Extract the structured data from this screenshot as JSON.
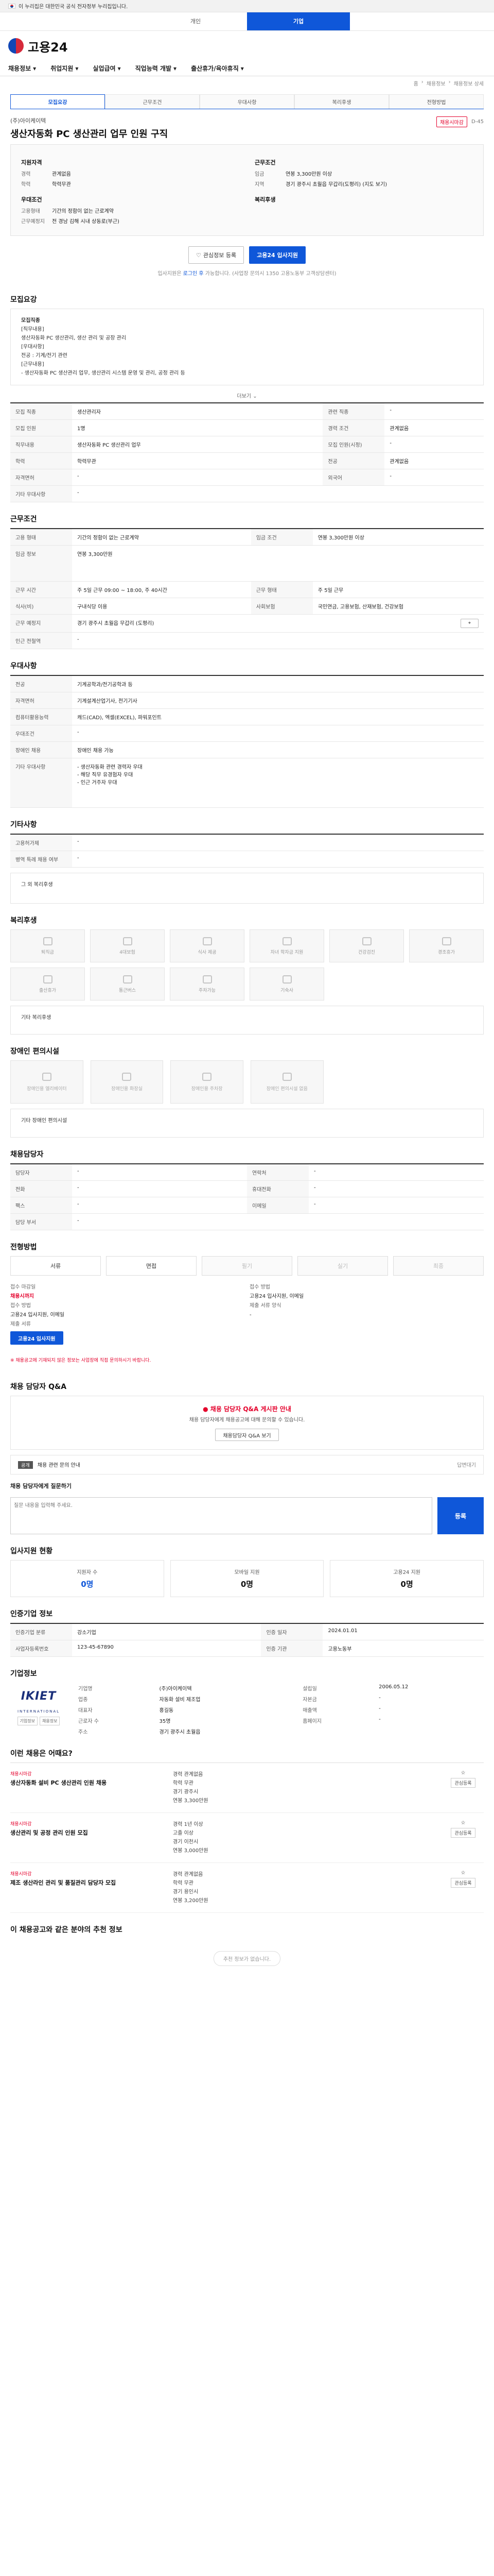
{
  "gov_banner": {
    "text": "이 누리집은 대한민국 공식 전자정부 누리집입니다."
  },
  "top_tabs": [
    "개인",
    "기업"
  ],
  "brand": {
    "name": "고용24"
  },
  "nav": [
    "채용정보",
    "취업지원",
    "실업급여",
    "직업능력 개발",
    "출산휴가/육아휴직"
  ],
  "breadcrumb": [
    "홈",
    "채용정보",
    "채용정보 상세"
  ],
  "tabs": [
    "모집요강",
    "근무조건",
    "우대사항",
    "복리후생",
    "전형방법"
  ],
  "job": {
    "company": "(주)아이케이텍",
    "title": "생산자동화 PC 생산관리 업무 인원 구직",
    "badge": "채용시마감",
    "dday": "D-45"
  },
  "summary": {
    "left_title": "지원자격",
    "left_rows": [
      {
        "k": "경력",
        "v": "관계없음"
      },
      {
        "k": "학력",
        "v": "학력무관"
      }
    ],
    "left_title2": "우대조건",
    "left_rows2": [
      {
        "k": "고용형태",
        "v": "기간의 정함이 없는 근로계약"
      },
      {
        "k": "근무예정지",
        "v": "전 경남 김해 시내 상동로(부근)"
      }
    ],
    "right_title": "근무조건",
    "right_rows": [
      {
        "k": "임금",
        "v": "연봉 3,300만원 이상"
      },
      {
        "k": "지역",
        "v": "경기 광주시 초월읍 무갑리(도평리) (지도 보기)"
      }
    ],
    "right_title2": "복리후생",
    "right_rows2": []
  },
  "actions": {
    "scrap": "관심정보 등록",
    "apply": "고용24 입사지원"
  },
  "notice": {
    "pre": "입사지원은 ",
    "link": "로그인 후",
    "post": " 가능합니다. (사업장 문의시 1350 고용노동부 고객상담센터)"
  },
  "sections": {
    "recruit": "모집요강",
    "work": "근무조건",
    "pref": "우대사항",
    "etc": "기타사항",
    "welfare": "복리후생",
    "disabled": "장애인 편의시설",
    "dept": "채용담당자",
    "process": "전형방법",
    "qa": "채용 담당자 Q&A",
    "stat": "입사지원 현황",
    "info": "인증기업 정보",
    "company": "기업정보",
    "recs": "이런 채용은 어때요?",
    "aicaution": "이 채용공고와 같은 분야의 추천 정보"
  },
  "recruit_box": {
    "lines": [
      "모집직종",
      "[직무내용]",
      "생산자동화 PC 생산관리, 생산 관리 및 공장 관리",
      "[우대사항]",
      "전공 : 기계/전기 관련",
      "[근무내용]",
      "- 생산자동화 PC 생산관리 업무, 생산관리 시스템 운영 및 관리, 공정 관리 등"
    ],
    "more": "더보기"
  },
  "recruit_table": [
    [
      "모집 직종",
      "생산관리자",
      "관련 직종",
      "-"
    ],
    [
      "모집 인원",
      "1명",
      "경력 조건",
      "관계없음"
    ],
    [
      "직무내용",
      "생산자동화 PC 생산관리 업무",
      "모집 인원(시정)",
      "-"
    ],
    [
      "학력",
      "학력무관",
      "전공",
      "관계없음"
    ],
    [
      "자격면허",
      "-",
      "외국어",
      "-"
    ],
    [
      "기타 우대사항",
      "-",
      "",
      ""
    ]
  ],
  "work_table": [
    [
      "고용 형태",
      "기간의 정함이 없는 근로계약",
      "임금 조건",
      "연봉 3,300만원 이상"
    ],
    [
      "임금 정보",
      "연봉 3,300만원",
      "",
      ""
    ],
    [
      "근무 시간",
      "주 5일 근무 09:00 ~ 18:00, 주 40시간",
      "근무 형태",
      "주 5일 근무"
    ],
    [
      "식사(비)",
      "구내식당 이용",
      "사회보험",
      "국민연금, 고용보험, 산재보험, 건강보험"
    ],
    [
      "근무 예정지",
      "경기 광주시 초월읍 무갑리 (도평리)",
      "",
      ""
    ],
    [
      "인근 전철역",
      "-",
      "",
      ""
    ]
  ],
  "pref_table": [
    [
      "전공",
      "기계공학과/전기공학과 등"
    ],
    [
      "자격면허",
      "기계설계산업기사, 전기기사"
    ],
    [
      "컴퓨터활용능력",
      "캐드(CAD), 엑셀(EXCEL), 파워포인트"
    ],
    [
      "우대조건",
      "-"
    ],
    [
      "장애인 채용",
      "장애인 채용 가능"
    ],
    [
      "기타 우대사항",
      "- 생산자동화 관련 경력자 우대\n- 해당 직무 유경험자 우대\n- 인근 거주자 우대"
    ]
  ],
  "etc_table": [
    [
      "고용허가제",
      "-"
    ],
    [
      "병역 특례 채용 여부",
      "-"
    ]
  ],
  "etc_text": "그 외 복리후생",
  "welfare_items": [
    "퇴직금",
    "4대보험",
    "식사 제공",
    "자녀 학자금 지원",
    "건강검진",
    "경조휴가",
    "출산휴가",
    "통근버스",
    "주차가능",
    "기숙사"
  ],
  "welfare_note": "기타 복리후생",
  "disabled_items": [
    "장애인용 엘리베이터",
    "장애인용 화장실",
    "장애인용 주차장",
    "장애인 편의시설 없음"
  ],
  "disabled_note": "기타 장애인 편의시설",
  "dept_table": [
    [
      "담당자",
      "-",
      "연락처",
      "-"
    ],
    [
      "전화",
      "-",
      "휴대전화",
      "-"
    ],
    [
      "팩스",
      "-",
      "이메일",
      "-"
    ],
    [
      "담당 부서",
      "-",
      "",
      ""
    ]
  ],
  "process_steps": [
    "서류",
    "면접",
    "필기",
    "실기",
    "최종"
  ],
  "apply_info": {
    "left": [
      "접수 마감일",
      "채용시까지",
      "접수 방법",
      "고용24 입사지원, 이메일",
      "제출 서류"
    ],
    "right": [
      "접수 방법",
      "고용24 입사지원, 이메일",
      "제출 서류 양식",
      "-"
    ],
    "apply_btn": "고용24 입사지원"
  },
  "process_note": "※ 채용공고에 기재되지 않은 정보는 사업장에 직접 문의하시기 바랍니다.",
  "qa": {
    "title": "채용 담당자 Q&A 게시판 안내",
    "desc": "채용 담당자에게 채용공고에 대해 문의할 수 있습니다.",
    "link": "채용담당자 Q&A 보기",
    "item_tag": "공개",
    "item_title": "채용 관련 문의 안내",
    "item_reply": "답변대기",
    "input_title": "채용 담당자에게 질문하기",
    "placeholder": "질문 내용을 입력해 주세요.",
    "submit": "등록"
  },
  "stat": [
    {
      "label": "지원자 수",
      "value": "0명"
    },
    {
      "label": "모바일 지원",
      "value": "0명"
    },
    {
      "label": "고용24 지원",
      "value": "0명"
    }
  ],
  "info_table": [
    [
      "인증기업 분류",
      "강소기업",
      "인증 일자",
      "2024.01.01"
    ],
    [
      "사업자등록번호",
      "123-45-67890",
      "인증 기관",
      "고용노동부"
    ]
  ],
  "company": {
    "logo": "IKIET",
    "logo_sub": "INTERNATIONAL",
    "logo_btns": [
      "기업정보",
      "채용정보"
    ],
    "rows": [
      [
        "기업명",
        "(주)아이케이텍",
        "설립일",
        "2006.05.12"
      ],
      [
        "업종",
        "자동화 설비 제조업",
        "자본금",
        "-"
      ],
      [
        "대표자",
        "홍길동",
        "매출액",
        "-"
      ],
      [
        "근로자 수",
        "35명",
        "홈페이지",
        "-"
      ],
      [
        "주소",
        "경기 광주시 초월읍",
        "",
        ""
      ]
    ]
  },
  "recs": [
    {
      "co": "채용시마감",
      "title": "생산자동화 설비 PC 생산관리 인원 채용",
      "meta": [
        "경력 관계없음",
        "학력 무관",
        "경기 광주시",
        "연봉 3,300만원"
      ],
      "btn": "관심등록"
    },
    {
      "co": "채용시마감",
      "title": "생산관리 및 공정 관리 인원 모집",
      "meta": [
        "경력 1년 이상",
        "고졸 이상",
        "경기 이천시",
        "연봉 3,000만원"
      ],
      "btn": "관심등록"
    },
    {
      "co": "채용시마감",
      "title": "제조 생산라인 관리 및 품질관리 담당자 모집",
      "meta": [
        "경력 관계없음",
        "학력 무관",
        "경기 용인시",
        "연봉 3,200만원"
      ],
      "btn": "관심등록"
    }
  ],
  "bottom": {
    "pill": "추천 정보가 없습니다."
  }
}
